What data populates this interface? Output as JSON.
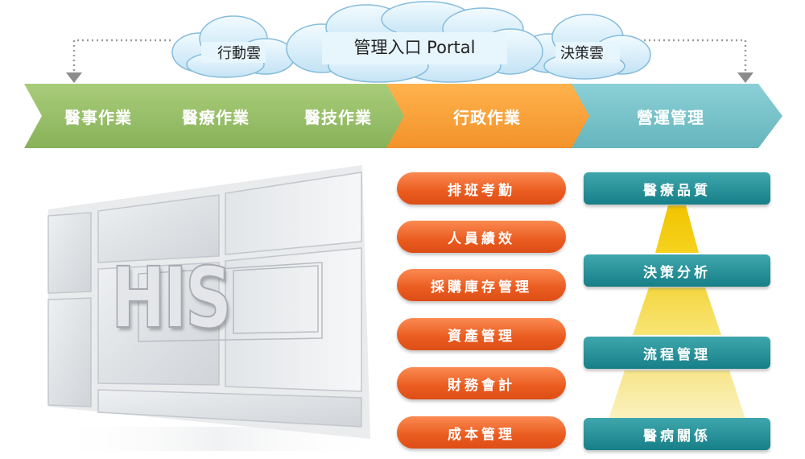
{
  "portal": {
    "title": "管理入口 Portal",
    "left_cloud": "行動雲",
    "right_cloud": "決策雲"
  },
  "stages": [
    {
      "label": "醫事作業"
    },
    {
      "label": "醫療作業"
    },
    {
      "label": "醫技作業"
    },
    {
      "label": "行政作業"
    },
    {
      "label": "營運管理"
    }
  ],
  "his_label": "HIS",
  "admin_items": [
    {
      "label": "排班考勤"
    },
    {
      "label": "人員績效"
    },
    {
      "label": "採購庫存管理"
    },
    {
      "label": "資產管理"
    },
    {
      "label": "財務會計"
    },
    {
      "label": "成本管理"
    }
  ],
  "ops_items": [
    {
      "label": "醫療品質"
    },
    {
      "label": "決策分析"
    },
    {
      "label": "流程管理"
    },
    {
      "label": "醫病關係"
    }
  ],
  "colors": {
    "stage_green": "#9bc16c",
    "stage_orange": "#f7a43b",
    "stage_teal": "#79c4cb",
    "pill_orange": "#ec5f22",
    "bar_teal": "#2a939b",
    "pyramid_yellow": "#f2cc11"
  }
}
